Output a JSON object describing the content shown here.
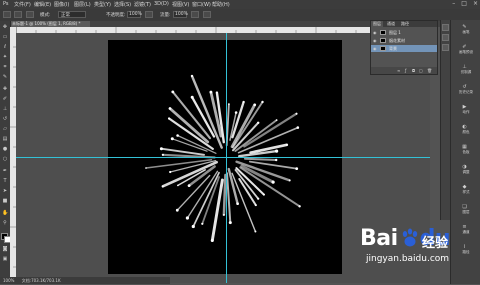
{
  "menubar": {
    "items": [
      "文件(F)",
      "编辑(E)",
      "图像(I)",
      "图层(L)",
      "类型(Y)",
      "选择(S)",
      "滤镜(T)",
      "3D(D)",
      "视图(V)",
      "窗口(W)",
      "帮助(H)"
    ],
    "window_controls": [
      "–",
      "□",
      "×"
    ]
  },
  "options_bar": {
    "mode_label": "模式:",
    "mode_value": "正常",
    "opacity_label": "不透明度:",
    "opacity_value": "100%",
    "flow_label": "流量:",
    "flow_value": "100%"
  },
  "document_tab": {
    "title": "未标题-1 @ 100% (图层 1, RGB/8) *"
  },
  "toolbar": {
    "tools": [
      "move-tool",
      "marquee-tool",
      "lasso-tool",
      "magic-wand-tool",
      "crop-tool",
      "eyedropper-tool",
      "healing-tool",
      "brush-tool",
      "clone-stamp-tool",
      "history-brush-tool",
      "eraser-tool",
      "gradient-tool",
      "blur-tool",
      "dodge-tool",
      "pen-tool",
      "type-tool",
      "path-select-tool",
      "shape-tool",
      "hand-tool",
      "zoom-tool"
    ]
  },
  "layers_panel": {
    "tabs": [
      "图层",
      "通道",
      "路径"
    ],
    "layers": [
      {
        "name": "图层 1",
        "selected": false
      },
      {
        "name": "烟花素材",
        "selected": false
      },
      {
        "name": "背景",
        "selected": true
      }
    ]
  },
  "right_panel": {
    "items": [
      {
        "icon": "brush-icon",
        "label": "画笔"
      },
      {
        "icon": "brush-preset-icon",
        "label": "画笔预设"
      },
      {
        "icon": "clone-source-icon",
        "label": "仿制源"
      },
      {
        "icon": "history-icon",
        "label": "历史记录"
      },
      {
        "icon": "actions-icon",
        "label": "动作"
      },
      {
        "icon": "color-icon",
        "label": "颜色"
      },
      {
        "icon": "swatches-icon",
        "label": "色板"
      },
      {
        "icon": "adjustments-icon",
        "label": "调整"
      },
      {
        "icon": "styles-icon",
        "label": "样式"
      },
      {
        "icon": "layers-icon",
        "label": "图层"
      },
      {
        "icon": "channels-icon",
        "label": "通道"
      },
      {
        "icon": "paths-icon",
        "label": "路径"
      }
    ]
  },
  "statusbar": {
    "zoom": "100%",
    "doc_info": "文档:703.1K/703.1K"
  },
  "watermark": {
    "logo_left": "Bai",
    "logo_right": "du",
    "chinese": "经验",
    "url": "jingyan.baidu.com"
  },
  "colors": {
    "guide": "#33c1d6",
    "canvas": "#000000",
    "workspace": "#4e4e4e",
    "baidu_blue": "#2a5fd6"
  }
}
